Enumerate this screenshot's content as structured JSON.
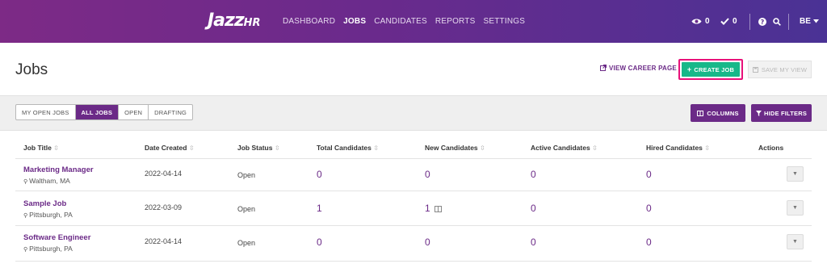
{
  "nav": {
    "logo": "JazzHR",
    "items": [
      "DASHBOARD",
      "JOBS",
      "CANDIDATES",
      "REPORTS",
      "SETTINGS"
    ],
    "active": "JOBS",
    "views_count": "0",
    "checks_count": "0",
    "user_initials": "BE"
  },
  "header": {
    "title": "Jobs",
    "view_career_page": "VIEW CAREER PAGE",
    "create_job": "CREATE JOB",
    "save_my_view": "SAVE MY VIEW"
  },
  "filters": {
    "segments": [
      "MY OPEN JOBS",
      "ALL JOBS",
      "OPEN",
      "DRAFTING"
    ],
    "selected": "ALL JOBS",
    "columns_label": "COLUMNS",
    "hide_filters_label": "HIDE FILTERS"
  },
  "table": {
    "columns": [
      "Job Title",
      "Date Created",
      "Job Status",
      "Total Candidates",
      "New Candidates",
      "Active Candidates",
      "Hired Candidates",
      "Actions"
    ],
    "rows": [
      {
        "title": "Marketing Manager",
        "location": "Waltham, MA",
        "date": "2022-04-14",
        "status": "Open",
        "total": "0",
        "new": "0",
        "active": "0",
        "hired": "0"
      },
      {
        "title": "Sample Job",
        "location": "Pittsburgh, PA",
        "date": "2022-03-09",
        "status": "Open",
        "total": "1",
        "new": "1",
        "active": "0",
        "hired": "0"
      },
      {
        "title": "Software Engineer",
        "location": "Pittsburgh, PA",
        "date": "2022-04-14",
        "status": "Open",
        "total": "0",
        "new": "0",
        "active": "0",
        "hired": "0"
      }
    ]
  },
  "colors": {
    "brand_purple": "#6b2a87",
    "create_green": "#17b889",
    "highlight_pink": "#e8127a"
  },
  "icons": {
    "views": "eye-icon",
    "checks": "check-icon",
    "help": "help-icon",
    "search": "search-icon",
    "dropdown": "caret-down-icon",
    "external": "external-link-icon",
    "create": "plus-icon",
    "save": "floppy-icon",
    "columns": "columns-icon",
    "filter": "filter-icon",
    "location": "map-pin-icon",
    "sort": "sort-icon",
    "calendar": "calendar-icon"
  }
}
